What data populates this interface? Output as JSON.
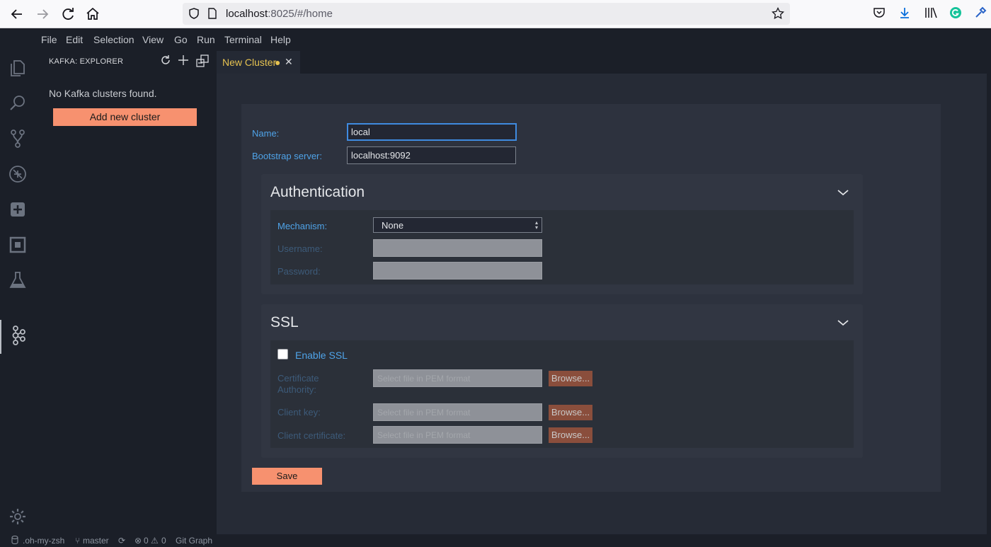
{
  "browser": {
    "url_host": "localhost",
    "url_rest": ":8025/#/home"
  },
  "menu": [
    "File",
    "Edit",
    "Selection",
    "View",
    "Go",
    "Run",
    "Terminal",
    "Help"
  ],
  "sidebar": {
    "title": "KAFKA: EXPLORER",
    "empty_message": "No Kafka clusters found.",
    "add_button": "Add new cluster"
  },
  "tab": {
    "label": "New Cluster",
    "dirty_dot": "●",
    "close": "✕"
  },
  "form": {
    "name_label": "Name:",
    "name_value": "local",
    "bootstrap_label": "Bootstrap server:",
    "bootstrap_value": "localhost:9092",
    "auth": {
      "title": "Authentication",
      "mechanism_label": "Mechanism:",
      "mechanism_value": "None",
      "username_label": "Username:",
      "password_label": "Password:"
    },
    "ssl": {
      "title": "SSL",
      "enable_label": "Enable SSL",
      "ca_label_line1": "Certificate",
      "ca_label_line2": "Authority:",
      "client_key_label": "Client key:",
      "client_cert_label": "Client certificate:",
      "file_placeholder": "Select file in PEM format",
      "browse_label": "Browse..."
    },
    "save_label": "Save"
  },
  "status": {
    "workspace": ".oh-my-zsh",
    "branch": "master",
    "errors": "0",
    "warnings": "0",
    "git_graph": "Git Graph"
  }
}
